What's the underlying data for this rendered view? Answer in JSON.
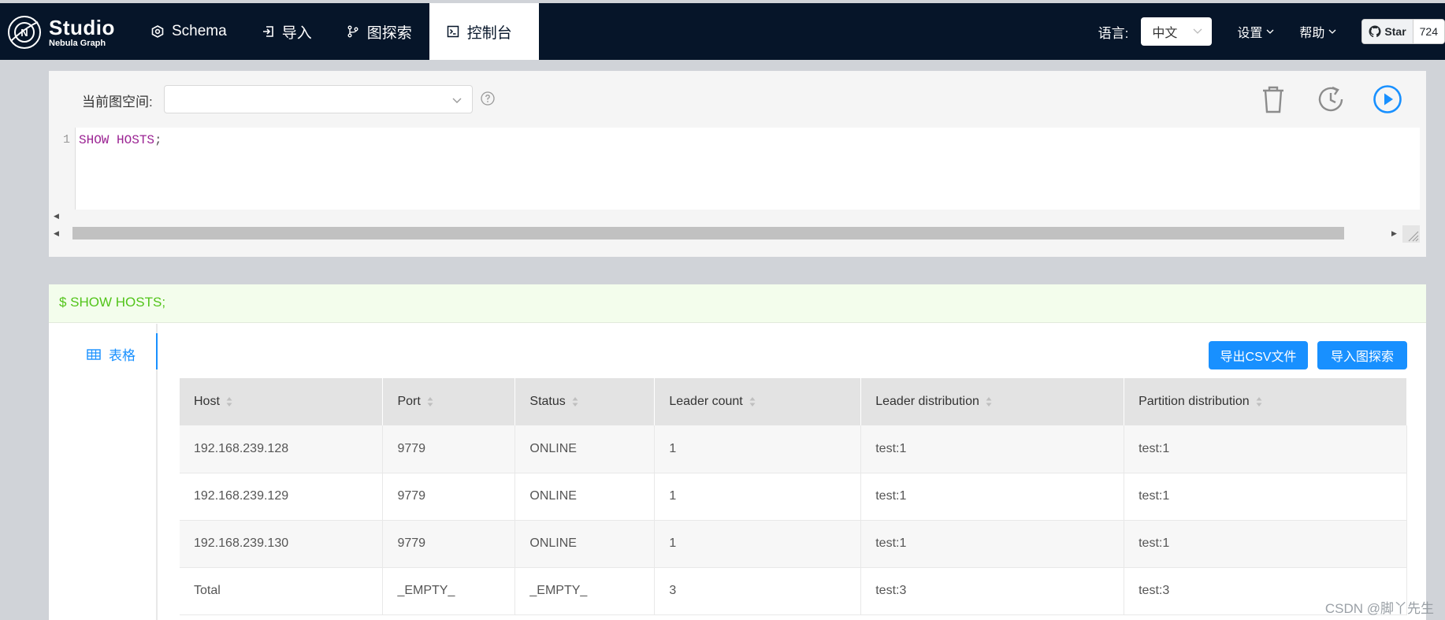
{
  "app": {
    "logo_title": "Studio",
    "logo_subtitle": "Nebula Graph"
  },
  "nav": {
    "items": [
      {
        "label": "Schema",
        "icon": "schema-icon"
      },
      {
        "label": "导入",
        "icon": "import-icon"
      },
      {
        "label": "图探索",
        "icon": "explore-icon"
      },
      {
        "label": "控制台",
        "icon": "console-icon",
        "active": true
      }
    ]
  },
  "header_tools": {
    "language_label": "语言:",
    "language_value": "中文",
    "settings_label": "设置",
    "help_label": "帮助",
    "github_star_label": "Star",
    "github_star_count": "724"
  },
  "editor": {
    "space_label": "当前图空间:",
    "space_value": "",
    "line_number": "1",
    "code": "SHOW HOSTS",
    "code_semicolon": ";",
    "toolbar_icons": [
      "trash-icon",
      "history-icon",
      "run-icon"
    ]
  },
  "result": {
    "query_header": "$ SHOW HOSTS;",
    "tab_table_label": "表格",
    "export_csv_label": "导出CSV文件",
    "import_explore_label": "导入图探索",
    "columns": [
      "Host",
      "Port",
      "Status",
      "Leader count",
      "Leader distribution",
      "Partition distribution"
    ],
    "rows": [
      [
        "192.168.239.128",
        "9779",
        "ONLINE",
        "1",
        "test:1",
        "test:1"
      ],
      [
        "192.168.239.129",
        "9779",
        "ONLINE",
        "1",
        "test:1",
        "test:1"
      ],
      [
        "192.168.239.130",
        "9779",
        "ONLINE",
        "1",
        "test:1",
        "test:1"
      ],
      [
        "Total",
        "_EMPTY_",
        "_EMPTY_",
        "3",
        "test:3",
        "test:3"
      ]
    ]
  },
  "watermark": "CSDN @脚丫先生",
  "colors": {
    "nav_bg": "#061529",
    "accent": "#1890ff",
    "result_header_bg": "#f3fdec",
    "result_header_text": "#52c41a",
    "code_keyword": "#9b2393"
  }
}
